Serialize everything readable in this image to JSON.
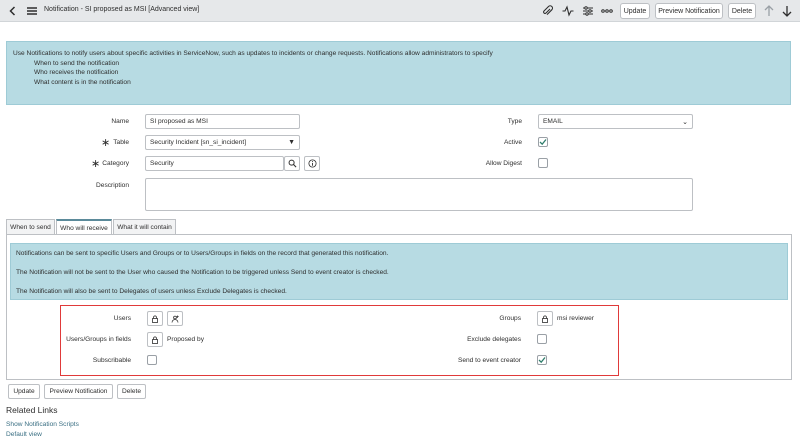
{
  "header": {
    "title": "Notification - SI proposed as MSI [Advanced view]",
    "buttons": {
      "update": "Update",
      "preview": "Preview Notification",
      "delete": "Delete"
    },
    "icons": [
      "back-icon",
      "menu-icon",
      "paperclip-icon",
      "activity-icon",
      "settings-icon",
      "more-icon",
      "arrow-up-icon",
      "arrow-down-icon"
    ]
  },
  "info": {
    "text": "Use Notifications to notify users about specific activities in ServiceNow, such as updates to incidents or change requests. Notifications allow administrators to specify",
    "bullets": [
      "When to send the notification",
      "Who receives the notification",
      "What content is in the notification"
    ]
  },
  "form": {
    "name_label": "Name",
    "name_value": "SI proposed as MSI",
    "table_label": "Table",
    "table_value": "Security Incident [sn_si_incident]",
    "category_label": "Category",
    "category_value": "Security",
    "description_label": "Description",
    "description_value": "",
    "type_label": "Type",
    "type_value": "EMAIL",
    "active_label": "Active",
    "active_checked": true,
    "allow_digest_label": "Allow Digest",
    "allow_digest_checked": false
  },
  "tabs": [
    {
      "label": "When to send",
      "active": false
    },
    {
      "label": "Who will receive",
      "active": true
    },
    {
      "label": "What it will contain",
      "active": false
    }
  ],
  "notice": {
    "line1": "Notifications can be sent to specific Users and Groups or to Users/Groups in fields on the record that generated this notification.",
    "line2": "The Notification will not be sent to the User who caused the Notification to be triggered unless Send to event creator is checked.",
    "line3": "The Notification will also be sent to Delegates of users unless Exclude Delegates is checked."
  },
  "recipients": {
    "users_label": "Users",
    "users_fields_label": "Users/Groups in fields",
    "users_fields_value": "Proposed by",
    "subscribable_label": "Subscribable",
    "subscribable_checked": false,
    "groups_label": "Groups",
    "groups_value": "msi reviewer",
    "exclude_delegates_label": "Exclude delegates",
    "exclude_delegates_checked": false,
    "send_to_creator_label": "Send to event creator",
    "send_to_creator_checked": true
  },
  "footer_buttons": {
    "update": "Update",
    "preview": "Preview Notification",
    "delete": "Delete"
  },
  "related": {
    "title": "Related Links",
    "links": [
      "Show Notification Scripts",
      "Default view"
    ]
  },
  "colors": {
    "info_bg": "#b7dbe3",
    "highlight_border": "#e03a3a",
    "link": "#3a6f83"
  }
}
